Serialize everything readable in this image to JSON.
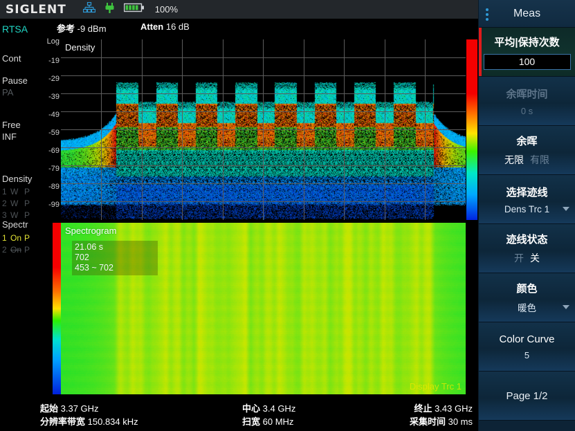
{
  "topbar": {
    "logo": "SIGLENT",
    "lan_icon": "lan-icon",
    "plug_icon": "power-plug-icon",
    "battery_icon": "battery-icon",
    "battery_percent": "100%"
  },
  "left_status": {
    "mode": "RTSA",
    "sweep": "Cont",
    "trigger": "Pause",
    "preamp": "PA",
    "run": "Free",
    "detector": "INF",
    "density_title": "Density",
    "density_traces": [
      {
        "num": "1",
        "mode": "W",
        "det": "P"
      },
      {
        "num": "2",
        "mode": "W",
        "det": "P"
      },
      {
        "num": "3",
        "mode": "W",
        "det": "P"
      }
    ],
    "spectr_title": "Spectr",
    "spectr_traces": [
      {
        "num": "1",
        "state": "On",
        "det": "P"
      },
      {
        "num": "2",
        "state": "On",
        "det": "P"
      }
    ]
  },
  "header": {
    "ref_label": "参考",
    "ref_value": "-9 dBm",
    "atten_label": "Atten",
    "atten_value": "16 dB"
  },
  "density_plot": {
    "title": "Density",
    "y_unit": "Log",
    "y_labels": [
      "-19",
      "-29",
      "-39",
      "-49",
      "-59",
      "-69",
      "-79",
      "-89",
      "-99"
    ]
  },
  "spectrogram": {
    "title": "Spectrogram",
    "time": "21.06 s",
    "frame": "702",
    "range": "453 ~ 702",
    "footer": "Display Trc 1"
  },
  "bottom": {
    "start_label": "起始",
    "start_value": "3.37 GHz",
    "center_label": "中心",
    "center_value": "3.4 GHz",
    "stop_label": "终止",
    "stop_value": "3.43 GHz",
    "rbw_label": "分辨率带宽",
    "rbw_value": "150.834 kHz",
    "span_label": "扫宽",
    "span_value": "60 MHz",
    "acq_label": "采集时间",
    "acq_value": "30 ms"
  },
  "menu": {
    "title": "Meas",
    "items": {
      "avg_hold": {
        "label": "平均|保持次数",
        "value": "100"
      },
      "persist_time": {
        "label": "余晖时间",
        "value": "0 s"
      },
      "persist": {
        "label": "余晖",
        "opt_a": "无限",
        "opt_b": "有限"
      },
      "select_trace": {
        "label": "选择迹线",
        "value": "Dens Trc 1"
      },
      "trace_state": {
        "label": "迹线状态",
        "opt_a": "开",
        "opt_b": "关"
      },
      "color": {
        "label": "颜色",
        "value": "暖色"
      },
      "color_curve": {
        "label": "Color Curve",
        "value": "5"
      },
      "page": {
        "label": "Page 1/2"
      }
    }
  }
}
